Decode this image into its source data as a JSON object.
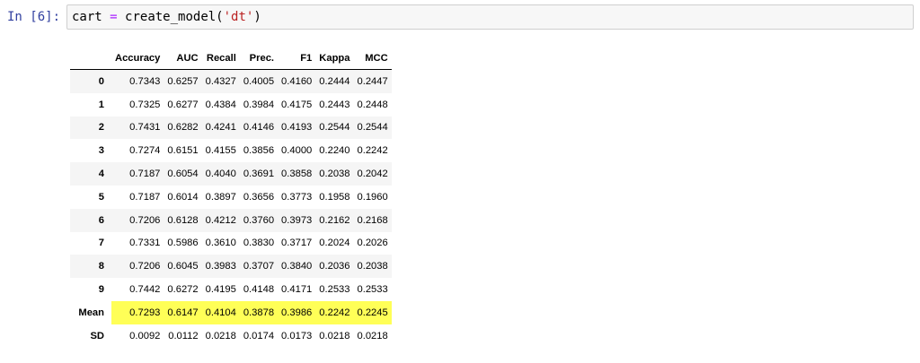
{
  "cell": {
    "prompt": "In [6]:",
    "code": {
      "var": "cart",
      "op": "=",
      "call": "create_model(",
      "arg": "'dt'",
      "close": ")"
    }
  },
  "table": {
    "columns": [
      "Accuracy",
      "AUC",
      "Recall",
      "Prec.",
      "F1",
      "Kappa",
      "MCC"
    ],
    "rows": [
      {
        "index": "0",
        "values": [
          "0.7343",
          "0.6257",
          "0.4327",
          "0.4005",
          "0.4160",
          "0.2444",
          "0.2447"
        ]
      },
      {
        "index": "1",
        "values": [
          "0.7325",
          "0.6277",
          "0.4384",
          "0.3984",
          "0.4175",
          "0.2443",
          "0.2448"
        ]
      },
      {
        "index": "2",
        "values": [
          "0.7431",
          "0.6282",
          "0.4241",
          "0.4146",
          "0.4193",
          "0.2544",
          "0.2544"
        ]
      },
      {
        "index": "3",
        "values": [
          "0.7274",
          "0.6151",
          "0.4155",
          "0.3856",
          "0.4000",
          "0.2240",
          "0.2242"
        ]
      },
      {
        "index": "4",
        "values": [
          "0.7187",
          "0.6054",
          "0.4040",
          "0.3691",
          "0.3858",
          "0.2038",
          "0.2042"
        ]
      },
      {
        "index": "5",
        "values": [
          "0.7187",
          "0.6014",
          "0.3897",
          "0.3656",
          "0.3773",
          "0.1958",
          "0.1960"
        ]
      },
      {
        "index": "6",
        "values": [
          "0.7206",
          "0.6128",
          "0.4212",
          "0.3760",
          "0.3973",
          "0.2162",
          "0.2168"
        ]
      },
      {
        "index": "7",
        "values": [
          "0.7331",
          "0.5986",
          "0.3610",
          "0.3830",
          "0.3717",
          "0.2024",
          "0.2026"
        ]
      },
      {
        "index": "8",
        "values": [
          "0.7206",
          "0.6045",
          "0.3983",
          "0.3707",
          "0.3840",
          "0.2036",
          "0.2038"
        ]
      },
      {
        "index": "9",
        "values": [
          "0.7442",
          "0.6272",
          "0.4195",
          "0.4148",
          "0.4171",
          "0.2533",
          "0.2533"
        ]
      },
      {
        "index": "Mean",
        "values": [
          "0.7293",
          "0.6147",
          "0.4104",
          "0.3878",
          "0.3986",
          "0.2242",
          "0.2245"
        ],
        "highlight": true
      },
      {
        "index": "SD",
        "values": [
          "0.0092",
          "0.0112",
          "0.0218",
          "0.0174",
          "0.0173",
          "0.0218",
          "0.0218"
        ]
      }
    ],
    "highlight_color": "#ffff57"
  }
}
